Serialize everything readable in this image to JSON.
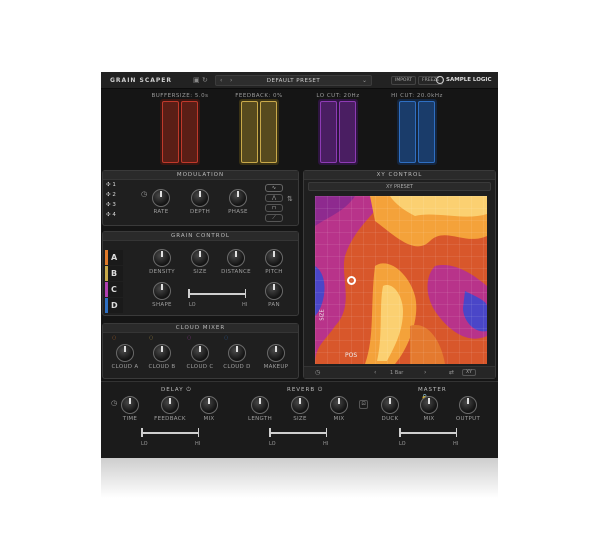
{
  "header": {
    "logo": "GRAIN SCAPER",
    "preset": "DEFAULT PRESET",
    "import_label": "IMPORT",
    "freeze_label": "FREEZE",
    "brand": "SAMPLE LOGIC"
  },
  "visualizers": [
    {
      "label": "BUFFERSIZE: 5.0s",
      "color": "#c0392b"
    },
    {
      "label": "FEEDBACK: 0%",
      "color": "#c9a94a"
    },
    {
      "label": "LO CUT: 20Hz",
      "color": "#8e3bb5"
    },
    {
      "label": "HI CUT: 20.0kHz",
      "color": "#2f6fc2"
    }
  ],
  "modulation": {
    "title": "MODULATION",
    "slots": [
      "1",
      "2",
      "3",
      "4"
    ],
    "knobs": [
      "RATE",
      "DEPTH",
      "PHASE"
    ]
  },
  "grain_control": {
    "title": "GRAIN CONTROL",
    "layers": [
      {
        "label": "A",
        "color": "#e07a2a"
      },
      {
        "label": "B",
        "color": "#c9a94a"
      },
      {
        "label": "C",
        "color": "#b040b0"
      },
      {
        "label": "D",
        "color": "#2f6fc2"
      }
    ],
    "knobs_row1": [
      "DENSITY",
      "SIZE",
      "DISTANCE",
      "PITCH"
    ],
    "knobs_row2": [
      "SHAPE",
      "PAN"
    ],
    "slider_lo": "LO",
    "slider_hi": "HI"
  },
  "cloud_mixer": {
    "title": "CLOUD MIXER",
    "knobs": [
      "CLOUD A",
      "CLOUD B",
      "CLOUD C",
      "CLOUD D",
      "MAKEUP"
    ]
  },
  "xy_control": {
    "title": "XY CONTROL",
    "preset": "XY PRESET",
    "x_label": "POS",
    "y_label": "SIZE",
    "footer_value": "1 Bar",
    "mode": "XY"
  },
  "delay": {
    "title": "DELAY",
    "knobs": [
      "TIME",
      "FEEDBACK",
      "MIX"
    ],
    "lo": "LO",
    "hi": "HI"
  },
  "reverb": {
    "title": "REVERB",
    "knobs": [
      "LENGTH",
      "SIZE",
      "MIX"
    ],
    "lo": "LO",
    "hi": "HI"
  },
  "master": {
    "title": "MASTER",
    "knobs": [
      "DUCK",
      "MIX",
      "OUTPUT"
    ],
    "lo": "LO",
    "hi": "HI"
  }
}
